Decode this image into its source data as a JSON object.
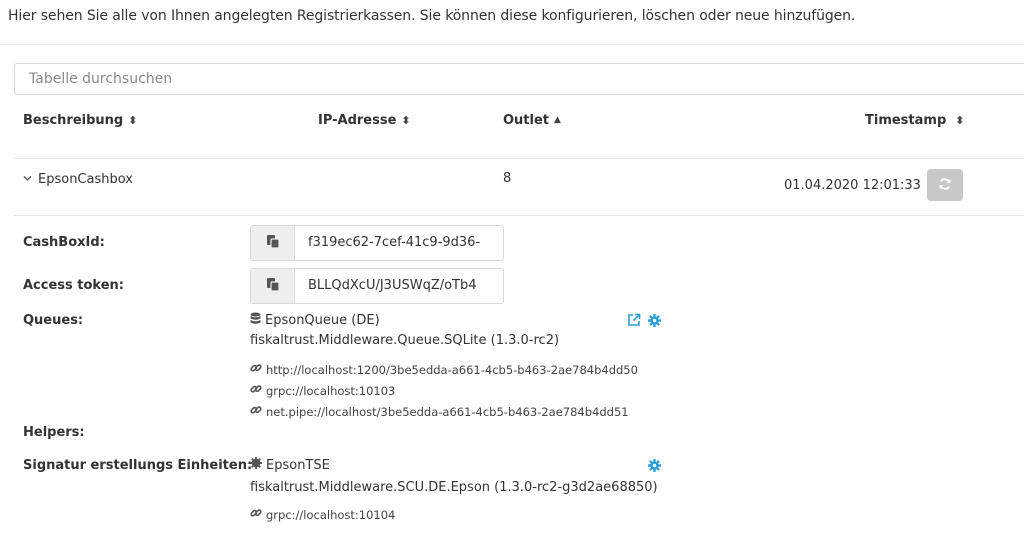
{
  "intro": "Hier sehen Sie alle von Ihnen angelegten Registrierkassen. Sie können diese konfigurieren, löschen oder neue hinzufügen.",
  "search": {
    "placeholder": "Tabelle durchsuchen"
  },
  "columns": [
    {
      "label": "Beschreibung",
      "sort": "both"
    },
    {
      "label": "IP-Adresse",
      "sort": "both"
    },
    {
      "label": "Outlet",
      "sort": "asc"
    },
    {
      "label": "Timestamp",
      "sort": "both"
    }
  ],
  "row": {
    "description": "EpsonCashbox",
    "outlet": "8",
    "timestamp": "01.04.2020 12:01:33"
  },
  "details": {
    "cashbox_id_label": "CashBoxId:",
    "cashbox_id_value": "f319ec62-7cef-41c9-9d36-",
    "access_token_label": "Access token:",
    "access_token_value": "BLLQdXcU/J3USWqZ/oTb4",
    "queues_label": "Queues:",
    "queue": {
      "name": "EpsonQueue (DE)",
      "package": "fiskaltrust.Middleware.Queue.SQLite (1.3.0-rc2)",
      "urls": [
        "http://localhost:1200/3be5edda-a661-4cb5-b463-2ae784b4dd50",
        "grpc://localhost:10103",
        "net.pipe://localhost/3be5edda-a661-4cb5-b463-2ae784b4dd51"
      ]
    },
    "helpers_label": "Helpers:",
    "scu_label": "Signatur erstellungs Einheiten:",
    "scu": {
      "name": "EpsonTSE",
      "package": "fiskaltrust.Middleware.SCU.DE.Epson (1.3.0-rc2-g3d2ae68850)",
      "urls": [
        "grpc://localhost:10104"
      ]
    }
  },
  "colors": {
    "accent": "#2a9fd6",
    "refresh_bg": "#c8c8c8"
  }
}
